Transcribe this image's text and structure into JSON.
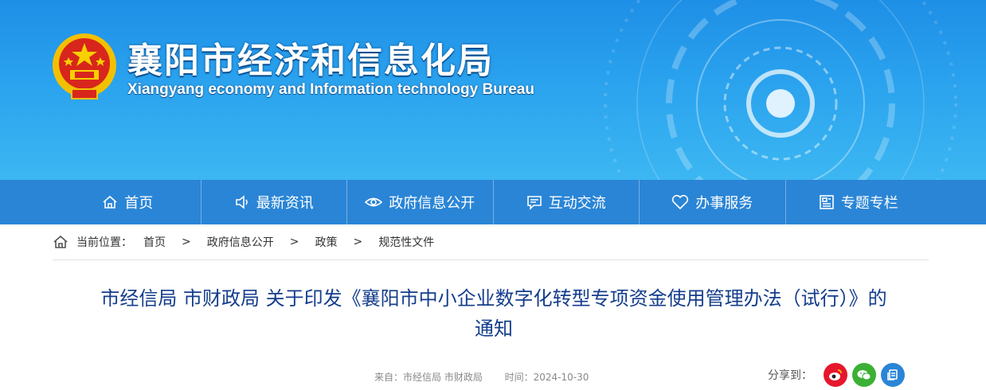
{
  "header": {
    "title": "襄阳市经济和信息化局",
    "subtitle": "Xiangyang economy and Information technology Bureau"
  },
  "nav": {
    "items": [
      {
        "label": "首页",
        "icon": "home-icon"
      },
      {
        "label": "最新资讯",
        "icon": "speaker-icon"
      },
      {
        "label": "政府信息公开",
        "icon": "eye-icon"
      },
      {
        "label": "互动交流",
        "icon": "chat-icon"
      },
      {
        "label": "办事服务",
        "icon": "heart-icon"
      },
      {
        "label": "专题专栏",
        "icon": "newspaper-icon"
      }
    ]
  },
  "breadcrumb": {
    "label": "当前位置：",
    "items": [
      "首页",
      "政府信息公开",
      "政策",
      "规范性文件"
    ],
    "separator": ">"
  },
  "article": {
    "title": "市经信局 市财政局 关于印发《襄阳市中小企业数字化转型专项资金使用管理办法（试行）》的通知",
    "source": "来自：市经信局 市财政局",
    "time": "时间：2024-10-30"
  },
  "share": {
    "label": "分享到：",
    "icons": [
      "weibo-icon",
      "wechat-icon",
      "copy-icon"
    ],
    "colors": {
      "weibo": "#e6162d",
      "wechat": "#3cb034",
      "copy": "#2a85d6"
    }
  },
  "colors": {
    "nav_bg": "#2a85d6",
    "title_color": "#143d8c"
  }
}
